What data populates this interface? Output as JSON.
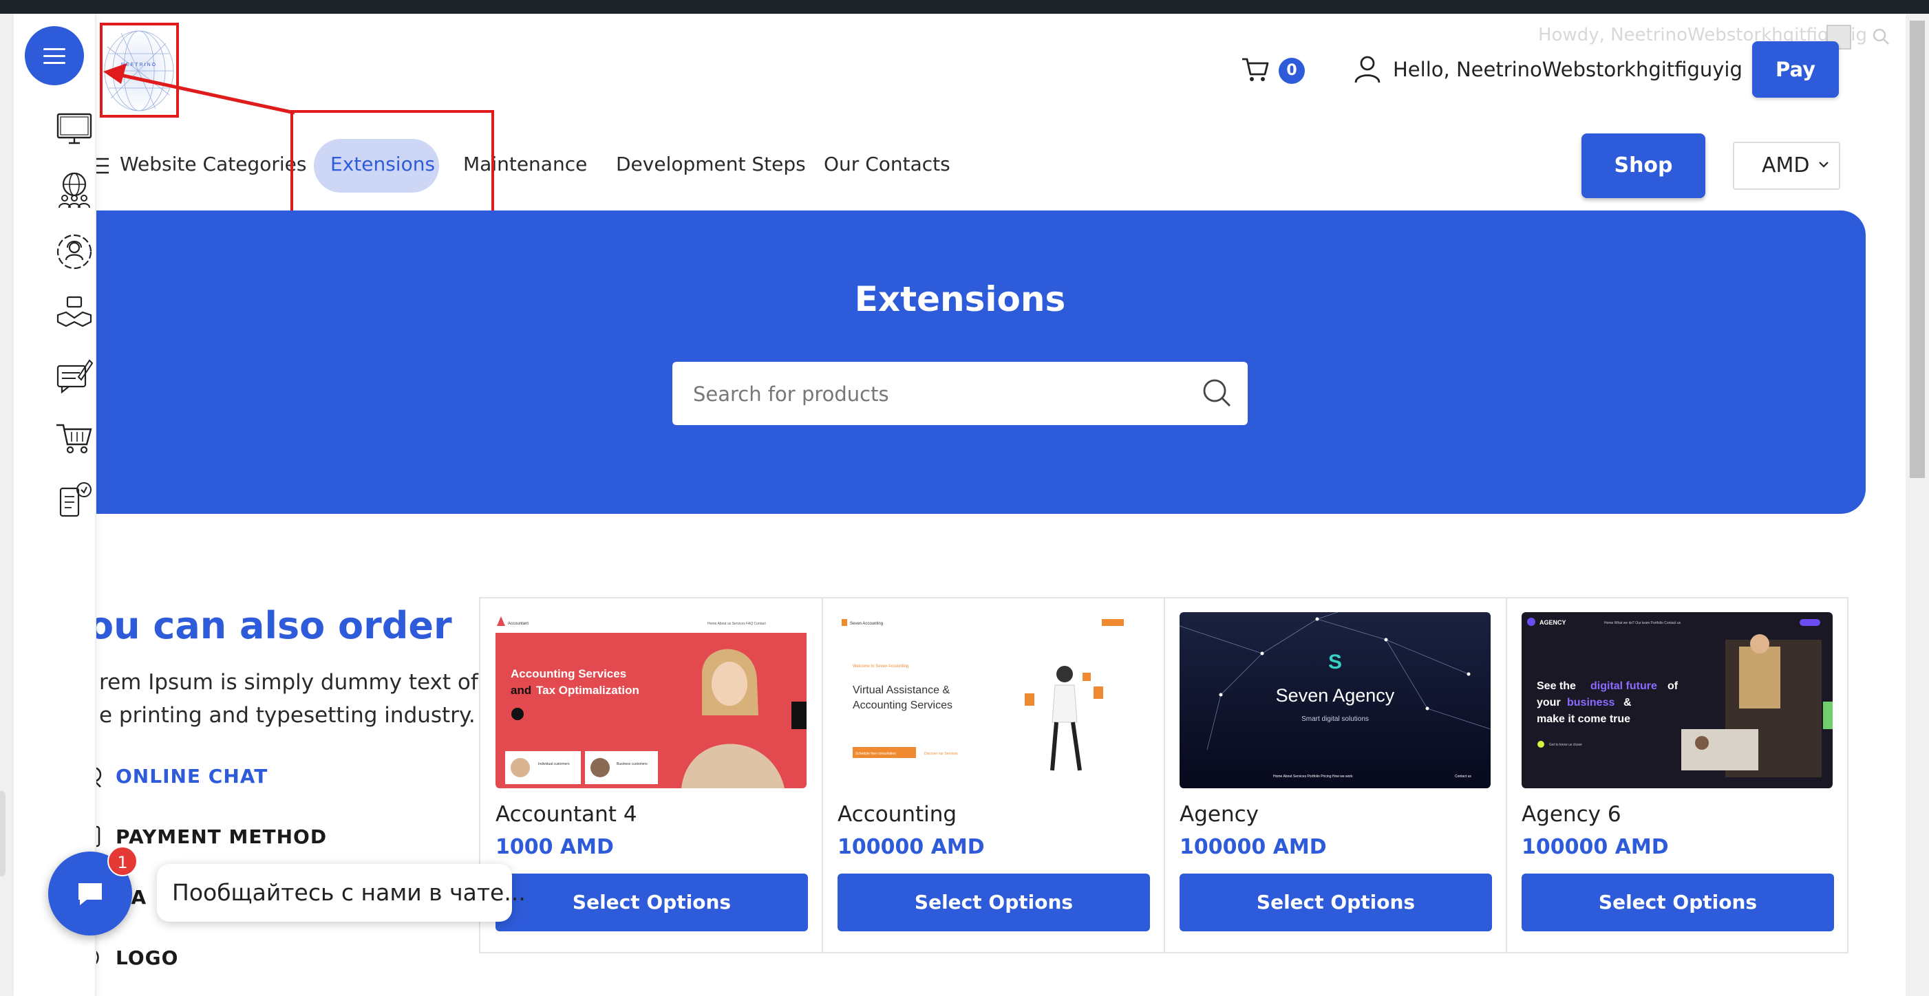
{
  "admin_bar": {
    "howdy": "Howdy, NeetrinoWebstorkhgitfiguyig"
  },
  "header": {
    "logo_text": "NEETRINO",
    "cart_count": "0",
    "greeting": "Hello, NeetrinoWebstorkhgitfiguyig",
    "pay_label": "Pay"
  },
  "nav": {
    "items": [
      {
        "label": "Website Categories"
      },
      {
        "label": "Extensions",
        "active": true
      },
      {
        "label": "Maintenance"
      },
      {
        "label": "Development Steps"
      },
      {
        "label": "Our Contacts"
      }
    ],
    "shop_label": "Shop",
    "currency": "AMD"
  },
  "sidebar": {
    "icons": [
      "monitor-icon",
      "globe-people-icon",
      "support-agent-icon",
      "handshake-briefcase-icon",
      "review-chat-icon",
      "shopping-cart-icon",
      "mobile-service-icon"
    ]
  },
  "hero": {
    "title": "Extensions",
    "search_placeholder": "Search for products"
  },
  "also_order": {
    "title": "ou can also order",
    "text_line1": "rem Ipsum is simply dummy text of",
    "text_line2": "e printing and typesetting industry.",
    "links": [
      {
        "label": "ONLINE CHAT",
        "color": "#2e5bd9"
      },
      {
        "label": "PAYMENT METHOD",
        "color": "#1a1a1a"
      },
      {
        "label": "RA",
        "color": "#1a1a1a"
      },
      {
        "label": "LOGO",
        "color": "#1a1a1a"
      }
    ]
  },
  "products": [
    {
      "name": "Accountant 4",
      "price": "1000 AMD",
      "button": "Select Options",
      "thumb": {
        "brand": "Accountant",
        "headline1": "Accounting Services",
        "headline2a": "and",
        "headline2b": "Tax Optimalization",
        "nav": "Home  About us  Services  FAQ  Contact",
        "card1": "Individual customers",
        "card2": "Business customers"
      }
    },
    {
      "name": "Accounting",
      "price": "100000 AMD",
      "button": "Select Options",
      "thumb": {
        "brand": "Seven Accounting",
        "kicker": "Welcome to Seven Accounting",
        "headline1": "Virtual Assistance &",
        "headline2": "Accounting Services",
        "cta1": "Schedule free consultation",
        "cta2": "Discover our Services"
      }
    },
    {
      "name": "Agency",
      "price": "100000 AMD",
      "button": "Select Options",
      "thumb": {
        "headline": "Seven Agency",
        "sub": "Smart digital solutions",
        "nav": "Home  About  Services  Portfolio  Pricing  How we work",
        "contact": "Contact us"
      }
    },
    {
      "name": "Agency 6",
      "price": "100000 AMD",
      "button": "Select Options",
      "thumb": {
        "brand": "AGENCY",
        "line1a": "See the",
        "line1b": "digital future",
        "line1c": "of",
        "line2a": "your",
        "line2b": "business",
        "line2c": "&",
        "line3": "make it come true",
        "cta": "Get to know us closer",
        "nav": "Home  What we do?  Our team  Portfolio  Contact us"
      }
    }
  ],
  "chat": {
    "badge": "1",
    "message": "Пообщайтесь с нами в чате..."
  },
  "colors": {
    "accent": "#2e5bd9",
    "highlight_red": "#e01b1b",
    "admin_bar": "#1d2327"
  }
}
